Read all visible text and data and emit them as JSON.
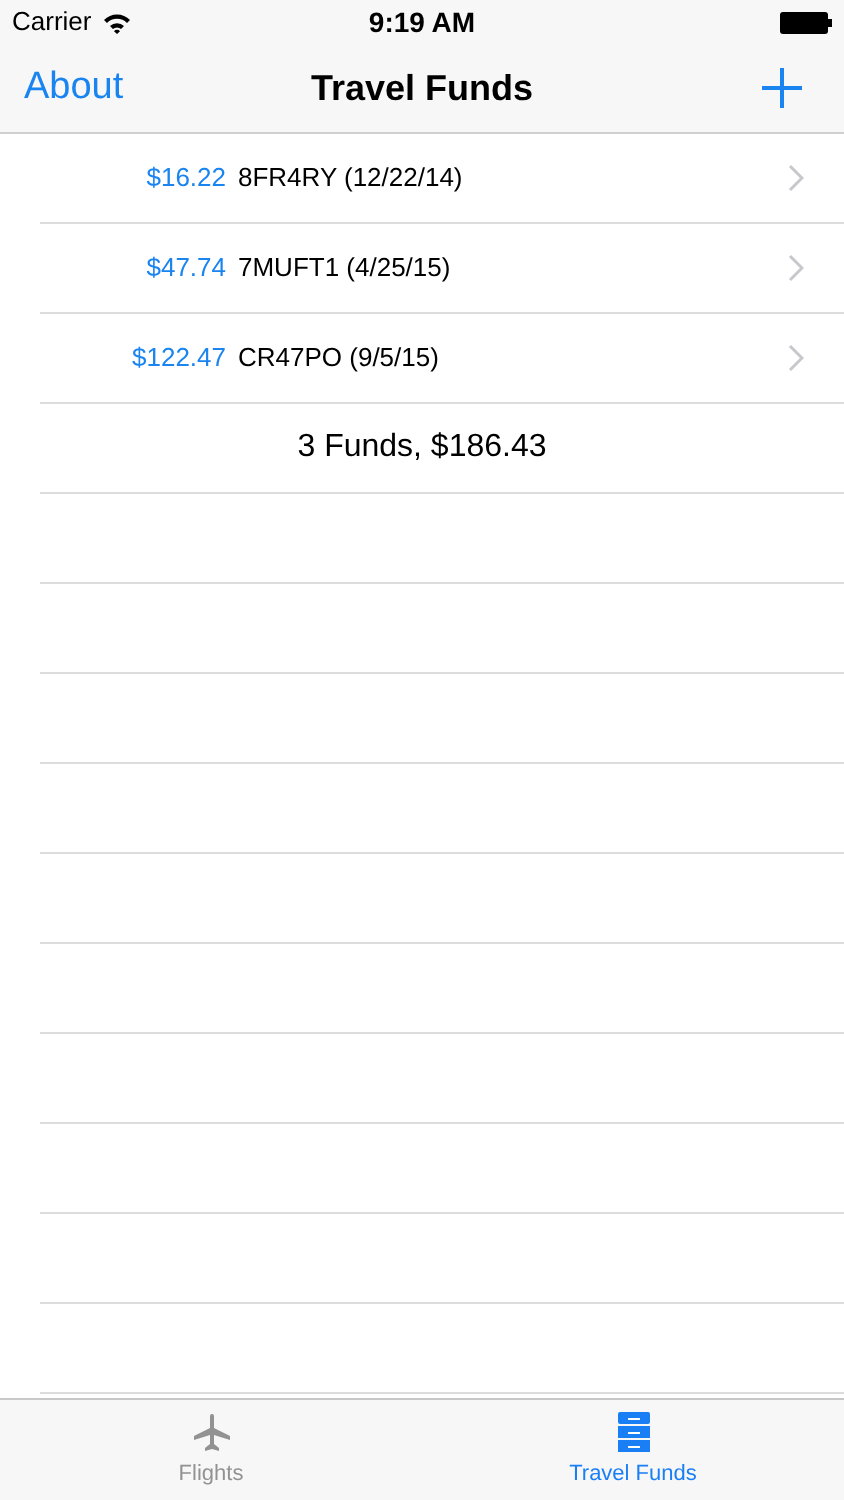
{
  "status_bar": {
    "carrier": "Carrier",
    "time": "9:19 AM"
  },
  "nav": {
    "left": "About",
    "title": "Travel Funds"
  },
  "funds": [
    {
      "amount": "$16.22",
      "label": "8FR4RY (12/22/14)"
    },
    {
      "amount": "$47.74",
      "label": "7MUFT1 (4/25/15)"
    },
    {
      "amount": "$122.47",
      "label": "CR47PO (9/5/15)"
    }
  ],
  "summary": "3 Funds, $186.43",
  "tabs": [
    {
      "label": "Flights",
      "selected": false
    },
    {
      "label": "Travel Funds",
      "selected": true
    }
  ]
}
